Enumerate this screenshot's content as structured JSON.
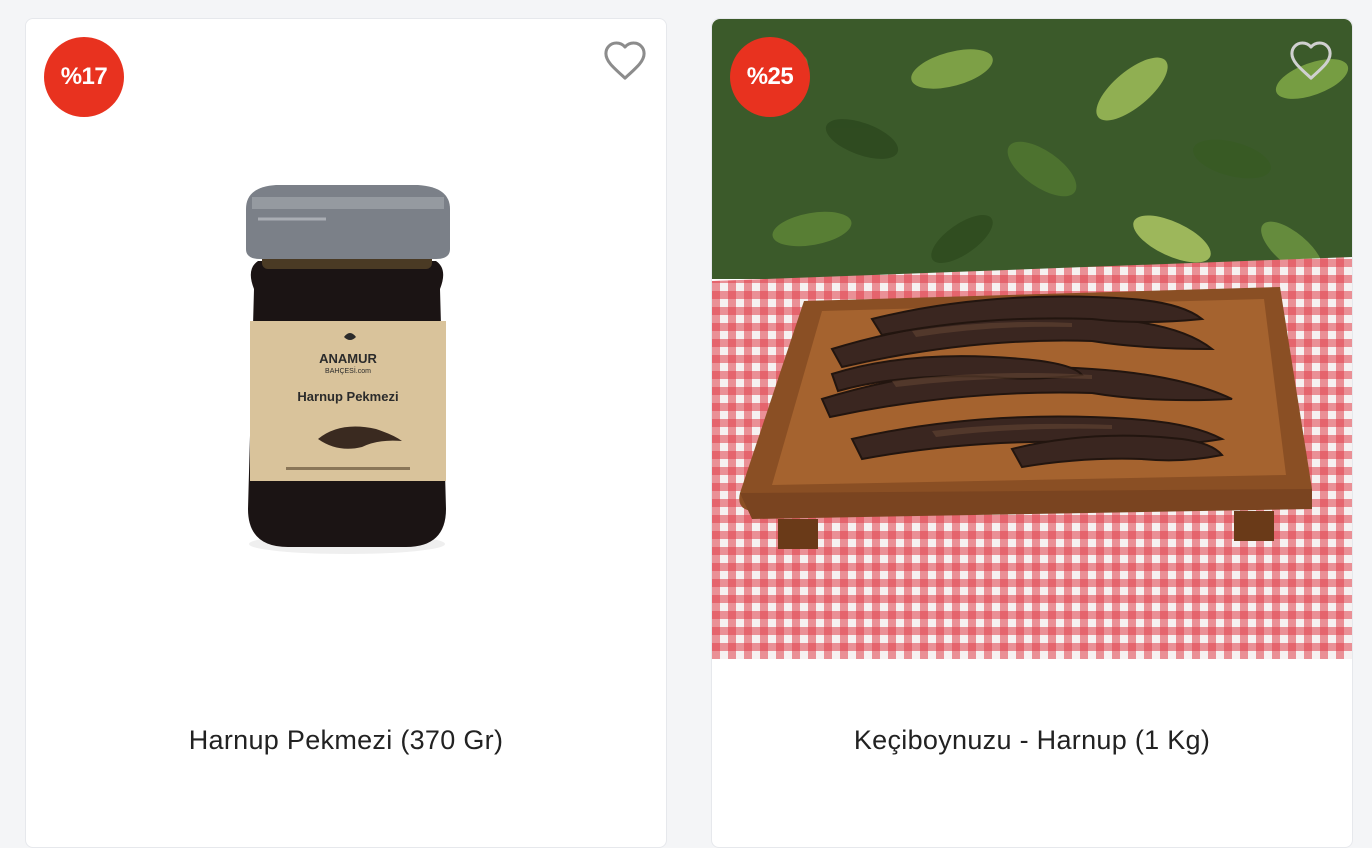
{
  "products": [
    {
      "discount": "%17",
      "title": "Harnup Pekmezi (370 Gr)",
      "label_brand_line1": "ANAMUR",
      "label_brand_line2": "BAHÇESİ.com",
      "label_product": "Harnup Pekmezi"
    },
    {
      "discount": "%25",
      "title": "Keçiboynuzu - Harnup (1 Kg)"
    }
  ],
  "icons": {
    "favorite": "heart-outline-icon"
  },
  "colors": {
    "badge": "#e8321f",
    "card_bg": "#ffffff",
    "page_bg": "#f4f5f7"
  }
}
